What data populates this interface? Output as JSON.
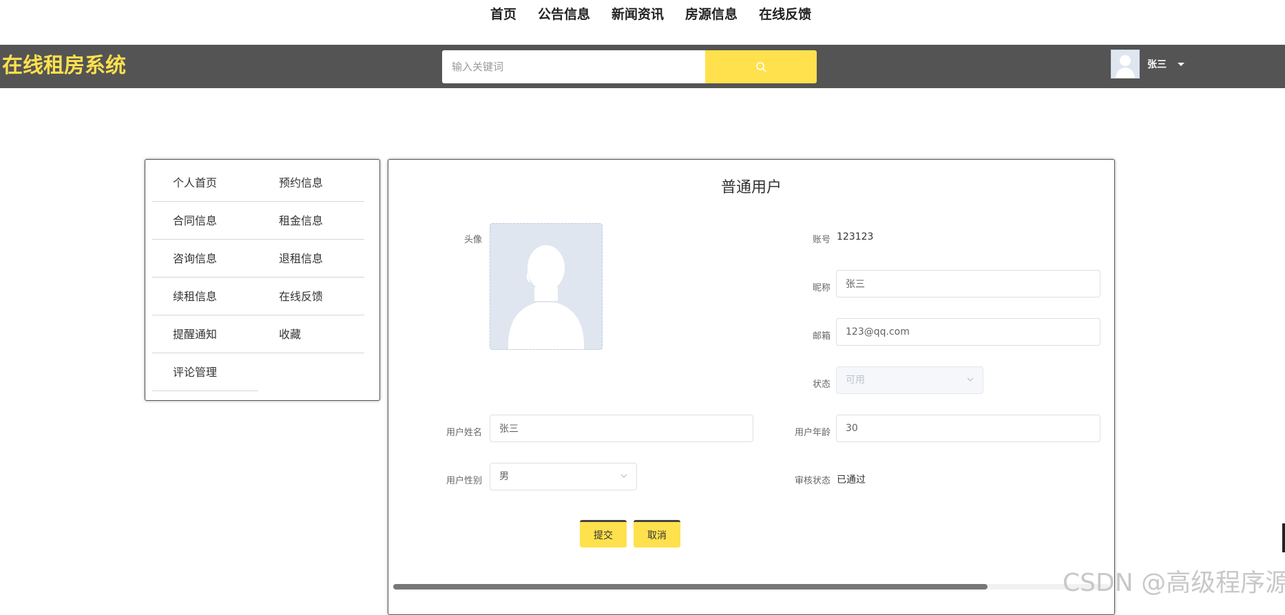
{
  "topnav": {
    "items": [
      "首页",
      "公告信息",
      "新闻资讯",
      "房源信息",
      "在线反馈"
    ]
  },
  "header": {
    "brand": "在线租房系统",
    "search_placeholder": "输入关键词",
    "search_icon": "search-icon",
    "user_name": "张三",
    "accent_color": "#ffe14d",
    "bar_color": "#545454"
  },
  "sidebar": {
    "items": [
      {
        "label": "个人首页"
      },
      {
        "label": "预约信息"
      },
      {
        "label": "合同信息"
      },
      {
        "label": "租金信息"
      },
      {
        "label": "咨询信息"
      },
      {
        "label": "退租信息"
      },
      {
        "label": "续租信息"
      },
      {
        "label": "在线反馈"
      },
      {
        "label": "提醒通知"
      },
      {
        "label": "收藏"
      },
      {
        "label": "评论管理"
      }
    ]
  },
  "profile": {
    "title": "普通用户",
    "avatar_label": "头像",
    "account_label": "账号",
    "account_value": "123123",
    "nickname_label": "昵称",
    "nickname_value": "张三",
    "email_label": "邮箱",
    "email_value": "123@qq.com",
    "status_label": "状态",
    "status_value": "可用",
    "name_label": "用户姓名",
    "name_value": "张三",
    "age_label": "用户年龄",
    "age_value": "30",
    "gender_label": "用户性别",
    "gender_value": "男",
    "review_label": "审核状态",
    "review_value": "已通过",
    "submit_label": "提交",
    "cancel_label": "取消"
  },
  "horizontal_scroll_fraction": 0.83,
  "watermark": "CSDN @高级程序源"
}
